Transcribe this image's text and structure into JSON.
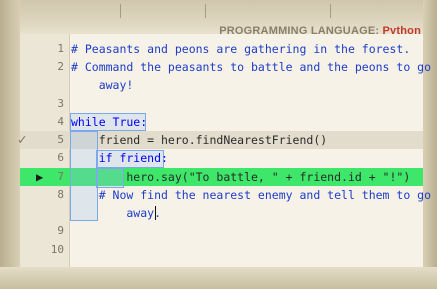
{
  "header": {
    "language_label": "PROGRAMMING LANGUAGE:",
    "language_value": "Python"
  },
  "editor": {
    "lines": [
      {
        "num": "1",
        "text": "# Peasants and peons are gathering in the forest."
      },
      {
        "num": "2",
        "text": "# Command the peasants to battle and the peons to go"
      },
      {
        "num": "",
        "text": "    away!"
      },
      {
        "num": "3",
        "text": ""
      },
      {
        "num": "4",
        "text": "while True:"
      },
      {
        "num": "5",
        "text": "    friend = hero.findNearestFriend()"
      },
      {
        "num": "6",
        "text": "    if friend:"
      },
      {
        "num": "7",
        "text": "        hero.say(\"To battle, \" + friend.id + \"!\")"
      },
      {
        "num": "8",
        "text": "    # Now find the nearest enemy and tell them to go"
      },
      {
        "num": "",
        "text": "        away."
      },
      {
        "num": "9",
        "text": ""
      },
      {
        "num": "10",
        "text": ""
      }
    ],
    "line5_marker": "✓",
    "line7_marker": "▶"
  },
  "colors": {
    "active_line": "#3ee66a",
    "check_line": "#e2dccd",
    "comment": "#1e3cc8",
    "keyword": "#0000ff"
  }
}
